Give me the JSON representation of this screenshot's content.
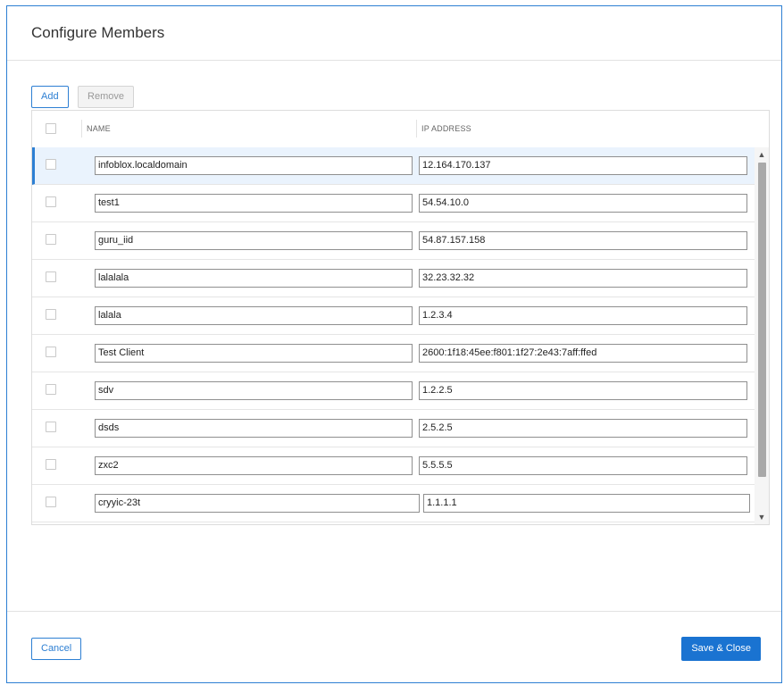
{
  "dialog": {
    "title": "Configure Members"
  },
  "toolbar": {
    "add_label": "Add",
    "remove_label": "Remove"
  },
  "grid": {
    "columns": {
      "name": "NAME",
      "ip": "IP ADDRESS"
    },
    "rows": [
      {
        "name": "infoblox.localdomain",
        "ip": "12.164.170.137",
        "selected": true
      },
      {
        "name": "test1",
        "ip": "54.54.10.0"
      },
      {
        "name": "guru_iid",
        "ip": "54.87.157.158"
      },
      {
        "name": "lalalala",
        "ip": "32.23.32.32"
      },
      {
        "name": "lalala",
        "ip": "1.2.3.4"
      },
      {
        "name": "Test Client",
        "ip": "2600:1f18:45ee:f801:1f27:2e43:7aff:ffed"
      },
      {
        "name": "sdv",
        "ip": "1.2.2.5"
      },
      {
        "name": "dsds",
        "ip": "2.5.2.5"
      },
      {
        "name": "zxc2",
        "ip": "5.5.5.5"
      },
      {
        "name": "cryyic-23t",
        "ip": "1.1.1.1"
      }
    ]
  },
  "footer": {
    "cancel_label": "Cancel",
    "save_label": "Save & Close"
  },
  "colors": {
    "accent": "#2d7fd3",
    "primary_button": "#1a73d1",
    "selected_row": "#eaf3fd"
  }
}
